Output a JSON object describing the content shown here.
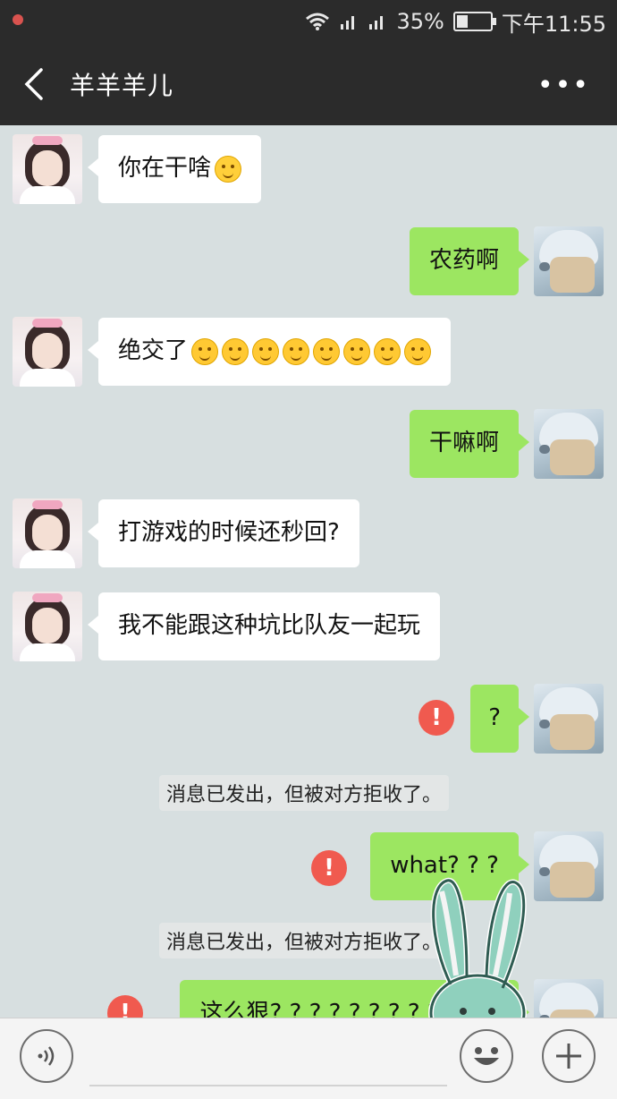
{
  "status_bar": {
    "signal_percent": "35%",
    "time": "下午11:55",
    "battery_level": 0.35
  },
  "header": {
    "title": "羊羊羊儿",
    "more_label": "•••"
  },
  "messages": [
    {
      "side": "in",
      "text": "你在干啥"
    },
    {
      "side": "out",
      "text": "农药啊"
    },
    {
      "side": "in",
      "text": "绝交了"
    },
    {
      "side": "out",
      "text": "干嘛啊"
    },
    {
      "side": "in",
      "text": "打游戏的时候还秒回?"
    },
    {
      "side": "in",
      "text": "我不能跟这种坑比队友一起玩"
    },
    {
      "side": "out",
      "text": "?",
      "failed": true
    },
    {
      "side": "system",
      "text": "消息已发出，但被对方拒收了。"
    },
    {
      "side": "out",
      "text": "what? ? ?",
      "failed": true
    },
    {
      "side": "system",
      "text": "消息已发出，但被对方拒收了。"
    },
    {
      "side": "out",
      "text": "这么狠? ? ? ? ? ? ? ? ? ? ? ?",
      "failed": true
    }
  ],
  "error_mark": "!",
  "colors": {
    "header_bg": "#2b2b2b",
    "chat_bg": "#d7dfe0",
    "out_bubble": "#9ce661",
    "in_bubble": "#ffffff",
    "error": "#f05a4f"
  },
  "input": {
    "placeholder": ""
  }
}
